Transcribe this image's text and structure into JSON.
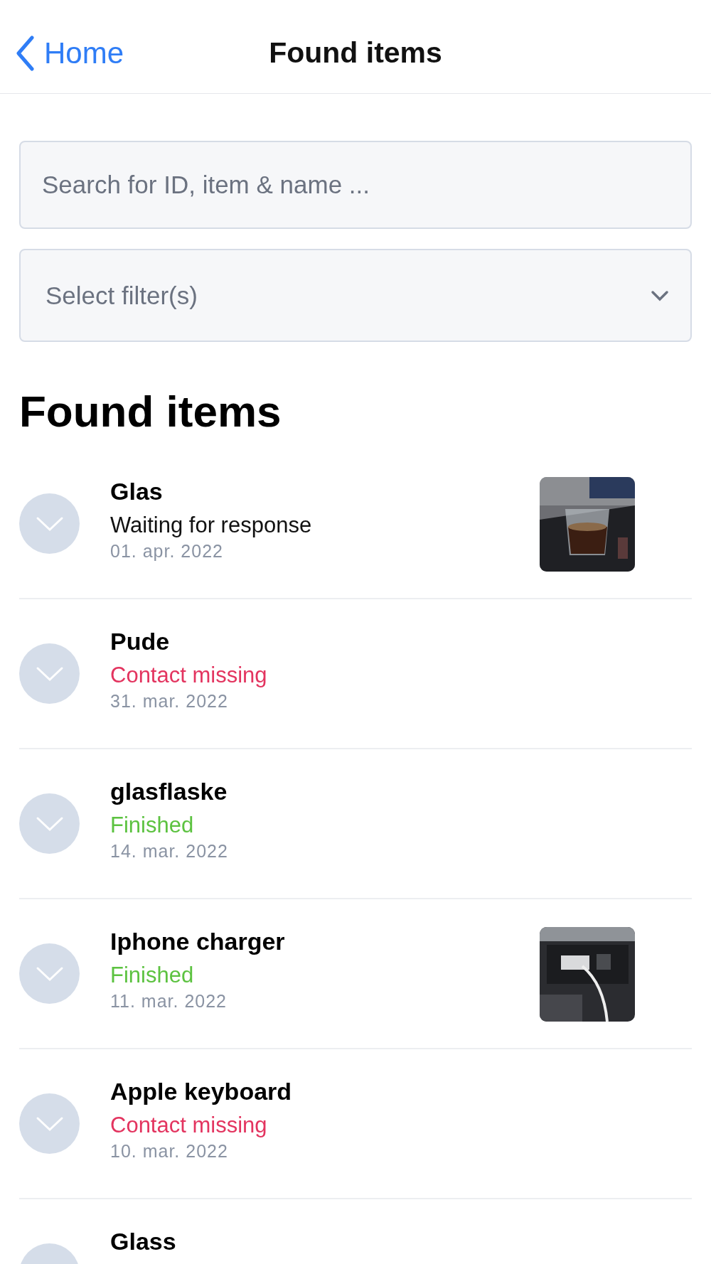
{
  "nav": {
    "back_label": "Home",
    "title": "Found items"
  },
  "search": {
    "placeholder": "Search for ID, item & name ..."
  },
  "filter": {
    "placeholder": "Select filter(s)"
  },
  "heading": "Found items",
  "items": [
    {
      "name": "Glas",
      "status": "Waiting for response",
      "color": "#111111",
      "date": "01. apr. 2022",
      "kind": "picture"
    },
    {
      "name": "Pude",
      "status": "Contact missing",
      "color": "#e3345f",
      "date": "31. mar. 2022"
    },
    {
      "name": "glasflaske",
      "status": "Finished",
      "color": "#5cc240",
      "date": "14. mar. 2022"
    },
    {
      "name": "Iphone charger",
      "status": "Finished",
      "color": "#5cc240",
      "date": "11. mar. 2022",
      "kind": "picture"
    },
    {
      "name": "Apple keyboard",
      "status": "Contact missing",
      "color": "#e3345f",
      "date": "10. mar. 2022"
    },
    {
      "name": "Glass"
    }
  ]
}
